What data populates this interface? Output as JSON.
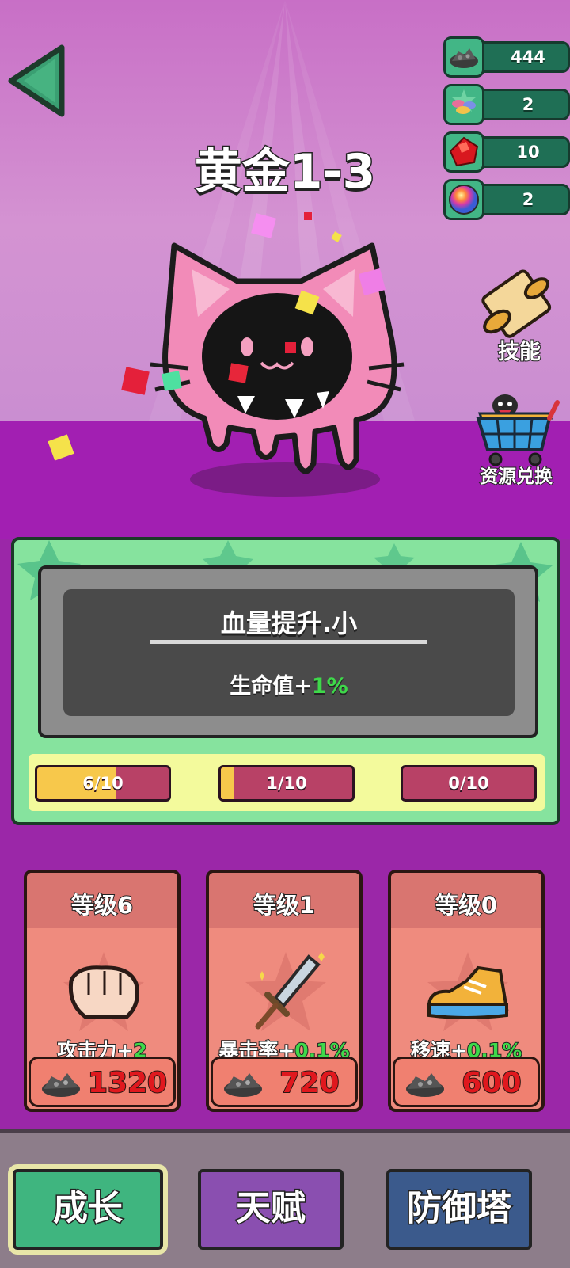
{
  "header": {
    "back_icon": "back-arrow-icon",
    "level_title": "黄金1-3"
  },
  "resources": [
    {
      "icon": "ore-rock-icon",
      "value": "444"
    },
    {
      "icon": "gem-pile-icon",
      "value": "2"
    },
    {
      "icon": "red-crystal-icon",
      "value": "10"
    },
    {
      "icon": "rainbow-orb-icon",
      "value": "2"
    }
  ],
  "side_buttons": {
    "skills": {
      "label": "技能",
      "icon": "scroll-icon"
    },
    "exchange": {
      "label": "资源兑换",
      "icon": "shopping-cart-icon"
    }
  },
  "enemy": {
    "icon": "pink-cat-slime-monster"
  },
  "buff_card": {
    "title": "血量提升.小",
    "desc_prefix": "生命值+",
    "desc_value": "1%"
  },
  "progress": [
    {
      "label": "6/10",
      "fraction": 0.6
    },
    {
      "label": "1/10",
      "fraction": 0.1
    },
    {
      "label": "0/10",
      "fraction": 0.0
    }
  ],
  "upgrades": [
    {
      "level": "等级6",
      "icon": "fist-icon",
      "stat_prefix": "攻击力+",
      "stat_value": "2",
      "cost": "1320",
      "cost_icon": "ore-rock-icon"
    },
    {
      "level": "等级1",
      "icon": "sword-icon",
      "stat_prefix": "暴击率+",
      "stat_value": "0.1%",
      "cost": "720",
      "cost_icon": "ore-rock-icon"
    },
    {
      "level": "等级0",
      "icon": "sneaker-icon",
      "stat_prefix": "移速+",
      "stat_value": "0.1%",
      "cost": "600",
      "cost_icon": "ore-rock-icon"
    }
  ],
  "tabs": [
    {
      "label": "成长",
      "color": "#3fb57f",
      "active": true
    },
    {
      "label": "天赋",
      "color": "#8a4fb0",
      "active": false
    },
    {
      "label": "防御塔",
      "color": "#3b5a8c",
      "active": false
    }
  ]
}
